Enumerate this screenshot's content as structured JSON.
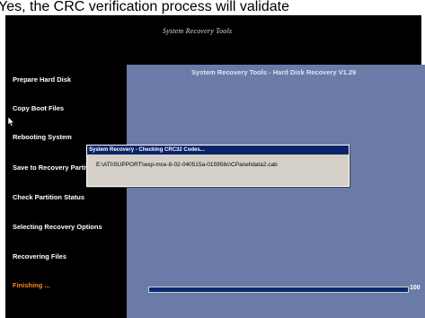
{
  "page_caption": "Yes, the CRC verification process will validate",
  "window_title": "System Recovery Tools",
  "sidebar": {
    "steps": [
      {
        "label": "Prepare Hard Disk",
        "state": "done"
      },
      {
        "label": "Copy Boot Files",
        "state": "done"
      },
      {
        "label": "Rebooting System",
        "state": "done"
      },
      {
        "label": "Save to Recovery Partition",
        "state": "done"
      },
      {
        "label": "Check Partition Status",
        "state": "done"
      },
      {
        "label": "Selecting Recovery Options",
        "state": "done"
      },
      {
        "label": "Recovering Files",
        "state": "done"
      },
      {
        "label": "Finishing ...",
        "state": "active"
      }
    ]
  },
  "main": {
    "title": "System Recovery Tools - Hard Disk Recovery V1.29",
    "progress": {
      "percent": 100,
      "label": "100"
    }
  },
  "dialog": {
    "title": "System Recovery - Checking CRC32 Codes...",
    "message": "E:\\ATI\\SUPPORT\\wxp-mce-8-02-040515a-015958c\\CPanel\\data2.cab"
  },
  "colors": {
    "sidebar_bg": "#000000",
    "main_bg": "#6a7ba7",
    "active_step": "#ff8a1e",
    "progress_fill": "#0b2a6e",
    "dialog_titlebar": "#0a246a"
  },
  "icons": [
    "mouse-pointer-icon"
  ]
}
